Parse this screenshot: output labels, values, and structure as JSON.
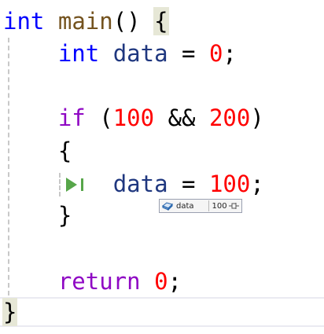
{
  "code": {
    "line1": {
      "kw": "int",
      "fn": "main",
      "parens": "()",
      "brace": "{"
    },
    "line2": {
      "kw": "int",
      "id": "data",
      "op": "=",
      "num": "0",
      "semi": ";"
    },
    "line4": {
      "kw": "if",
      "open": "(",
      "num1": "100",
      "op": "&&",
      "num2": "200",
      "close": ")"
    },
    "line5": {
      "brace": "{"
    },
    "line6": {
      "id": "data",
      "op": "=",
      "num": "100",
      "semi": ";"
    },
    "line7": {
      "brace": "}"
    },
    "line9": {
      "kw": "return",
      "num": "0",
      "semi": ";"
    },
    "line10": {
      "brace": "}"
    }
  },
  "datatip": {
    "name": "data",
    "value": "100"
  },
  "icons": {
    "execution_arrow": "next-statement-arrow-icon",
    "variable": "variable-icon",
    "pin": "pin-icon"
  },
  "colors": {
    "keyword": "#0000ff",
    "control_keyword": "#8f08c4",
    "function": "#74531f",
    "identifier": "#1f377f",
    "number": "#ff0000",
    "execution_arrow": "#57a64a"
  }
}
